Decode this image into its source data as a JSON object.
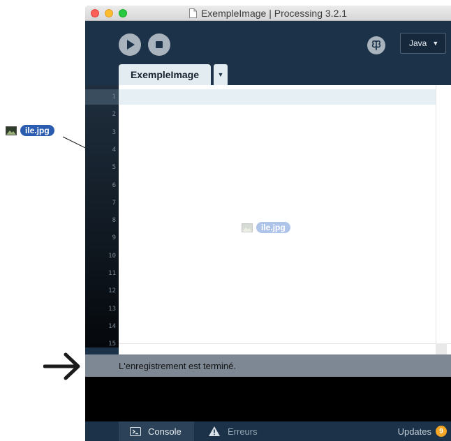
{
  "window": {
    "title": "ExempleImage | Processing 3.2.1"
  },
  "toolbar": {
    "run_icon": "play-icon",
    "stop_icon": "stop-icon",
    "mode_icon": "butterfly-icon",
    "mode_label": "Java",
    "mode_caret": "▼"
  },
  "tabs": {
    "items": [
      {
        "label": "ExempleImage",
        "active": true
      }
    ],
    "menu_caret": "▼"
  },
  "editor": {
    "line_numbers": [
      "1",
      "2",
      "3",
      "4",
      "5",
      "6",
      "7",
      "8",
      "9",
      "10",
      "11",
      "12",
      "13",
      "14",
      "15"
    ],
    "current_line": 1
  },
  "status": {
    "message": "L'enregistrement est terminé."
  },
  "footer": {
    "console_label": "Console",
    "errors_label": "Erreurs",
    "updates_label": "Updates",
    "updates_count": "9"
  },
  "annotations": {
    "source_file": "ile.jpg",
    "drop_file": "ile.jpg"
  },
  "colors": {
    "window_bg": "#1b3248",
    "editor_bg": "#ffffff",
    "current_line_bg": "#e6eff3",
    "status_bg": "#7d8894",
    "file_chip": "#2a5db0",
    "updates_badge": "#f5a623"
  }
}
